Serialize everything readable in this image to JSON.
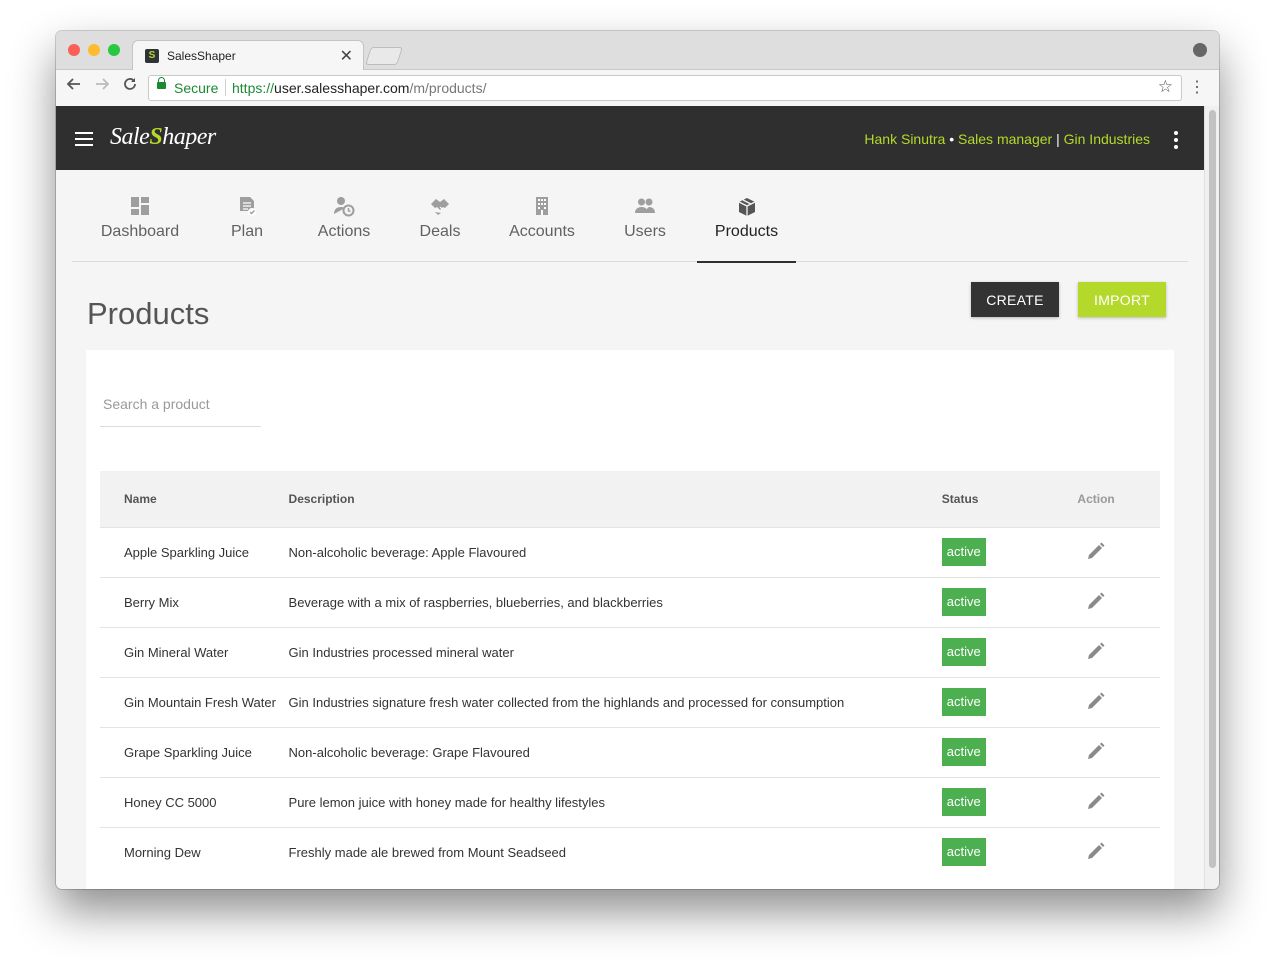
{
  "browser": {
    "tab_title": "SalesShaper",
    "tab_favicon": "S",
    "tab_close": "✕",
    "secure_label": "Secure",
    "url_scheme": "https://",
    "url_domain": "user.salesshaper.com",
    "url_path": "/m/products/"
  },
  "app": {
    "logo_prefix": "Sale",
    "logo_bolt": "S",
    "logo_suffix": "haper",
    "user_name": "Hank Sinutra",
    "separator_dot": " • ",
    "role": "Sales manager",
    "separator_bar": " | ",
    "company": "Gin Industries",
    "accent_color": "#b5d92a"
  },
  "nav": {
    "tabs": [
      {
        "label": "Dashboard",
        "icon": "dashboard-icon"
      },
      {
        "label": "Plan",
        "icon": "plan-icon"
      },
      {
        "label": "Actions",
        "icon": "actions-icon"
      },
      {
        "label": "Deals",
        "icon": "handshake-icon"
      },
      {
        "label": "Accounts",
        "icon": "building-icon"
      },
      {
        "label": "Users",
        "icon": "users-icon"
      },
      {
        "label": "Products",
        "icon": "box-icon",
        "active": true
      }
    ]
  },
  "page": {
    "title": "Products",
    "create_label": "CREATE",
    "import_label": "IMPORT",
    "search_placeholder": "Search a product"
  },
  "table": {
    "headers": {
      "name": "Name",
      "description": "Description",
      "status": "Status",
      "action": "Action"
    },
    "rows": [
      {
        "name": "Apple Sparkling Juice",
        "description": "Non-alcoholic beverage: Apple Flavoured",
        "status": "active"
      },
      {
        "name": "Berry Mix",
        "description": "Beverage with a mix of raspberries, blueberries, and blackberries",
        "status": "active"
      },
      {
        "name": "Gin Mineral Water",
        "description": "Gin Industries processed mineral water",
        "status": "active"
      },
      {
        "name": "Gin Mountain Fresh Water",
        "description": "Gin Industries signature fresh water collected from the highlands and processed for consumption",
        "status": "active"
      },
      {
        "name": "Grape Sparkling Juice",
        "description": "Non-alcoholic beverage: Grape Flavoured",
        "status": "active"
      },
      {
        "name": "Honey CC 5000",
        "description": "Pure lemon juice with honey made for healthy lifestyles",
        "status": "active"
      },
      {
        "name": "Morning Dew",
        "description": "Freshly made ale brewed from Mount Seadseed",
        "status": "active"
      }
    ]
  }
}
